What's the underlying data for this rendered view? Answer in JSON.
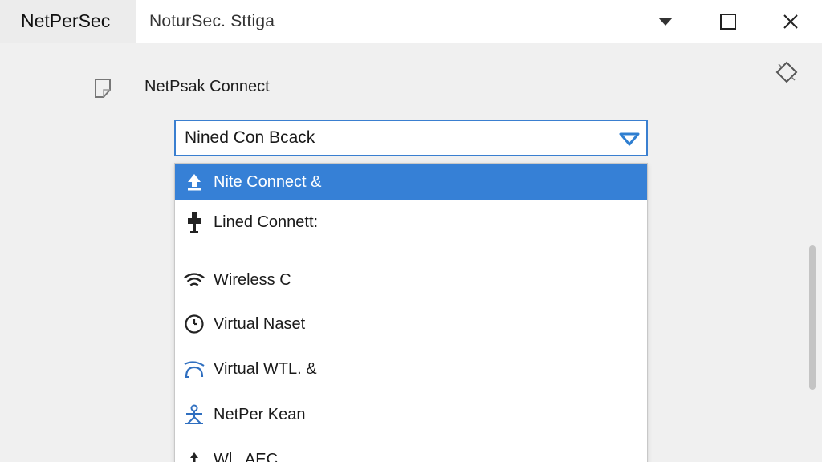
{
  "titlebar": {
    "app_name": "NetPerSec",
    "window_title": "NoturSec.  Sttiga",
    "controls": [
      "chevron-down-icon",
      "maximize-icon",
      "close-icon"
    ]
  },
  "section": {
    "title": "NetPsak Connect"
  },
  "combo": {
    "selected_value": "Nined Con Bcack"
  },
  "dropdown": {
    "items": [
      {
        "label": "Nite Connect &",
        "icon": "upload-icon",
        "selected": true
      },
      {
        "label": "Lined Connett:",
        "icon": "plug-icon",
        "selected": false
      },
      {
        "label": "Wireless C",
        "icon": "wifi-icon",
        "selected": false
      },
      {
        "label": "Virtual Naset",
        "icon": "compass-icon",
        "selected": false
      },
      {
        "label": "Virtual WTL. &",
        "icon": "signal-icon",
        "selected": false
      },
      {
        "label": "NetPer Kean",
        "icon": "network-icon",
        "selected": false
      },
      {
        "label": "Wl.. AEC",
        "icon": "arrow-up-icon",
        "selected": false
      }
    ]
  },
  "colors": {
    "accent": "#3680d6",
    "selected_text": "#ffffff",
    "background": "#f0f0f0"
  }
}
